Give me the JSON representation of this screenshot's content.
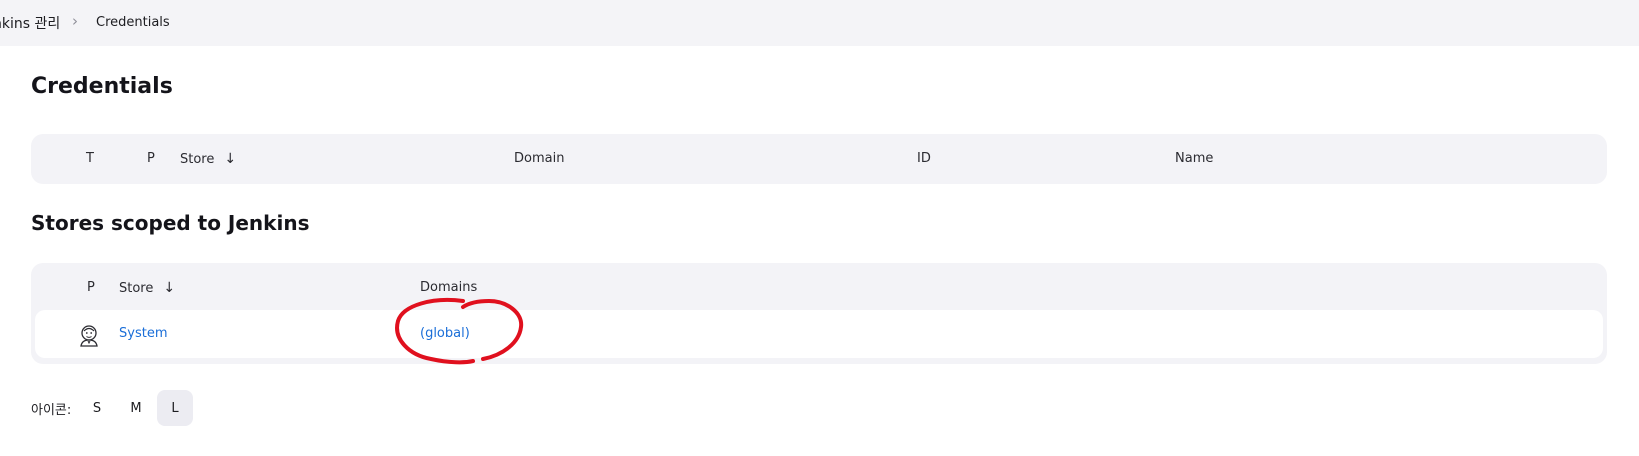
{
  "breadcrumb": {
    "home": "nkins 관리",
    "current": "Credentials"
  },
  "page": {
    "title": "Credentials",
    "stores_heading": "Stores scoped to Jenkins"
  },
  "credentials_table": {
    "columns": {
      "t": "T",
      "p": "P",
      "store": "Store",
      "domain": "Domain",
      "id": "ID",
      "name": "Name"
    },
    "sort_arrow": "↓"
  },
  "stores_table": {
    "columns": {
      "p": "P",
      "store": "Store",
      "domains": "Domains"
    },
    "sort_arrow": "↓",
    "rows": [
      {
        "store": "System",
        "domain": "(global)",
        "icon": "jenkins-icon"
      }
    ]
  },
  "icon_size": {
    "label": "아이콘:",
    "options": [
      "S",
      "M",
      "L"
    ],
    "selected": "L"
  },
  "colors": {
    "link": "#1a6ed8",
    "annotation": "#e0101e",
    "table_bg": "#f3f3f7"
  }
}
